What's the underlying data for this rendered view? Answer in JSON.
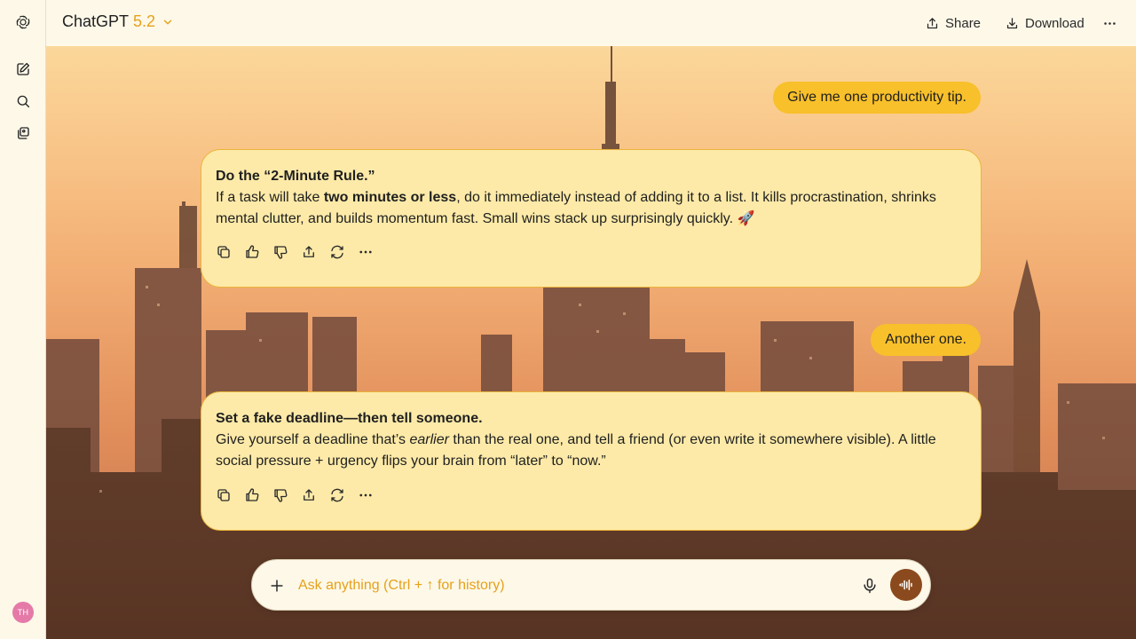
{
  "header": {
    "model_name": "ChatGPT",
    "model_version": "5.2",
    "share_label": "Share",
    "download_label": "Download"
  },
  "sidebar": {
    "avatar_initials": "TH",
    "icons": [
      "chatgpt-logo-icon",
      "new-chat-icon",
      "search-icon",
      "library-icon"
    ]
  },
  "conversation": {
    "messages": [
      {
        "role": "user",
        "text": "Give me one productivity tip."
      },
      {
        "role": "assistant",
        "title": "Do the “2-Minute Rule.”",
        "body_pre": "If a task will take ",
        "body_bold": "two minutes or less",
        "body_post": ", do it immediately instead of adding it to a list. It kills procrastination, shrinks mental clutter, and builds momentum fast. Small wins stack up surprisingly quickly. 🚀"
      },
      {
        "role": "user",
        "text": "Another one."
      },
      {
        "role": "assistant",
        "title": "Set a fake deadline—then tell someone.",
        "body_pre": "Give yourself a deadline that’s ",
        "body_italic": "earlier",
        "body_post": " than the real one, and tell a friend (or even write it somewhere visible). A little social pressure + urgency flips your brain from “later” to “now.”"
      }
    ]
  },
  "composer": {
    "placeholder": "Ask anything (Ctrl + ↑ for history)"
  },
  "colors": {
    "user_bubble": "#f8c02a",
    "assistant_bubble": "#fdeaa8",
    "assistant_border": "#eab43a",
    "accent": "#e6a11a",
    "voice_button": "#8b4a1d",
    "chrome_bg": "#fdf8e8"
  }
}
